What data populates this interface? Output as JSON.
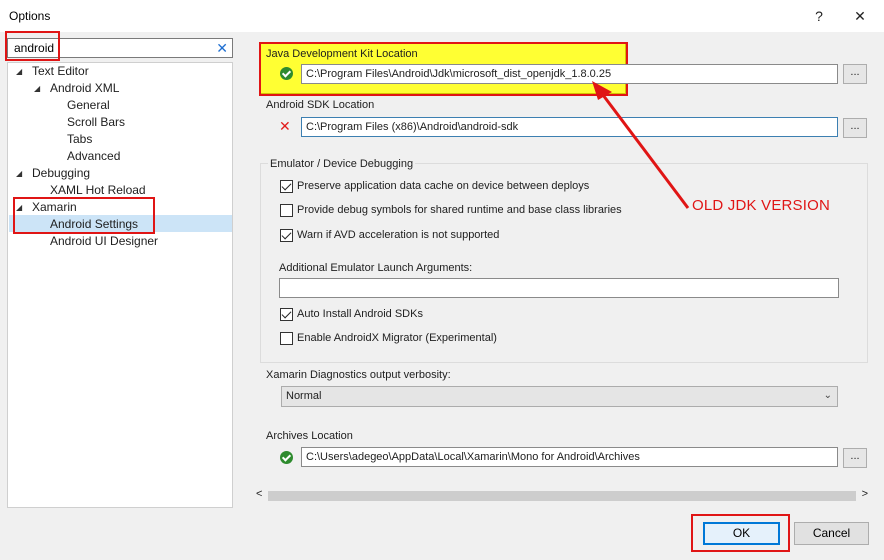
{
  "window": {
    "title": "Options",
    "help_label": "?",
    "close_label": "✕"
  },
  "search": {
    "value": "android",
    "clear_label": "✕"
  },
  "tree": {
    "items": [
      {
        "label": "Text Editor"
      },
      {
        "label": "Android XML"
      },
      {
        "label": "General"
      },
      {
        "label": "Scroll Bars"
      },
      {
        "label": "Tabs"
      },
      {
        "label": "Advanced"
      },
      {
        "label": "Debugging"
      },
      {
        "label": "XAML Hot Reload"
      },
      {
        "label": "Xamarin"
      },
      {
        "label": "Android Settings"
      },
      {
        "label": "Android UI Designer"
      }
    ],
    "selected": "Android Settings"
  },
  "jdk": {
    "label": "Java Development Kit Location",
    "value": "C:\\Program Files\\Android\\Jdk\\microsoft_dist_openjdk_1.8.0.25",
    "status": "ok",
    "browse_label": "..."
  },
  "sdk": {
    "label": "Android SDK Location",
    "value": "C:\\Program Files (x86)\\Android\\android-sdk",
    "status": "error",
    "browse_label": "..."
  },
  "emulator": {
    "group_label": "Emulator / Device Debugging",
    "options": [
      {
        "label": "Preserve application data cache on device between deploys",
        "checked": true
      },
      {
        "label": "Provide debug symbols for shared runtime and base class libraries",
        "checked": false
      },
      {
        "label": "Warn if AVD acceleration is not supported",
        "checked": true
      }
    ],
    "launch_args_label": "Additional Emulator Launch Arguments:",
    "launch_args_value": "",
    "options2": [
      {
        "label": "Auto Install Android SDKs",
        "checked": true
      },
      {
        "label": "Enable AndroidX Migrator (Experimental)",
        "checked": false
      }
    ]
  },
  "diagnostics": {
    "label": "Xamarin Diagnostics output verbosity:",
    "value": "Normal"
  },
  "archives": {
    "label": "Archives Location",
    "value": "C:\\Users\\adegeo\\AppData\\Local\\Xamarin\\Mono for Android\\Archives",
    "browse_label": "..."
  },
  "scroll": {
    "left_label": "<",
    "right_label": ">"
  },
  "buttons": {
    "ok": "OK",
    "cancel": "Cancel"
  },
  "annotation": {
    "text": "OLD JDK VERSION",
    "color": "#e01515",
    "highlight": "#ffff33"
  }
}
